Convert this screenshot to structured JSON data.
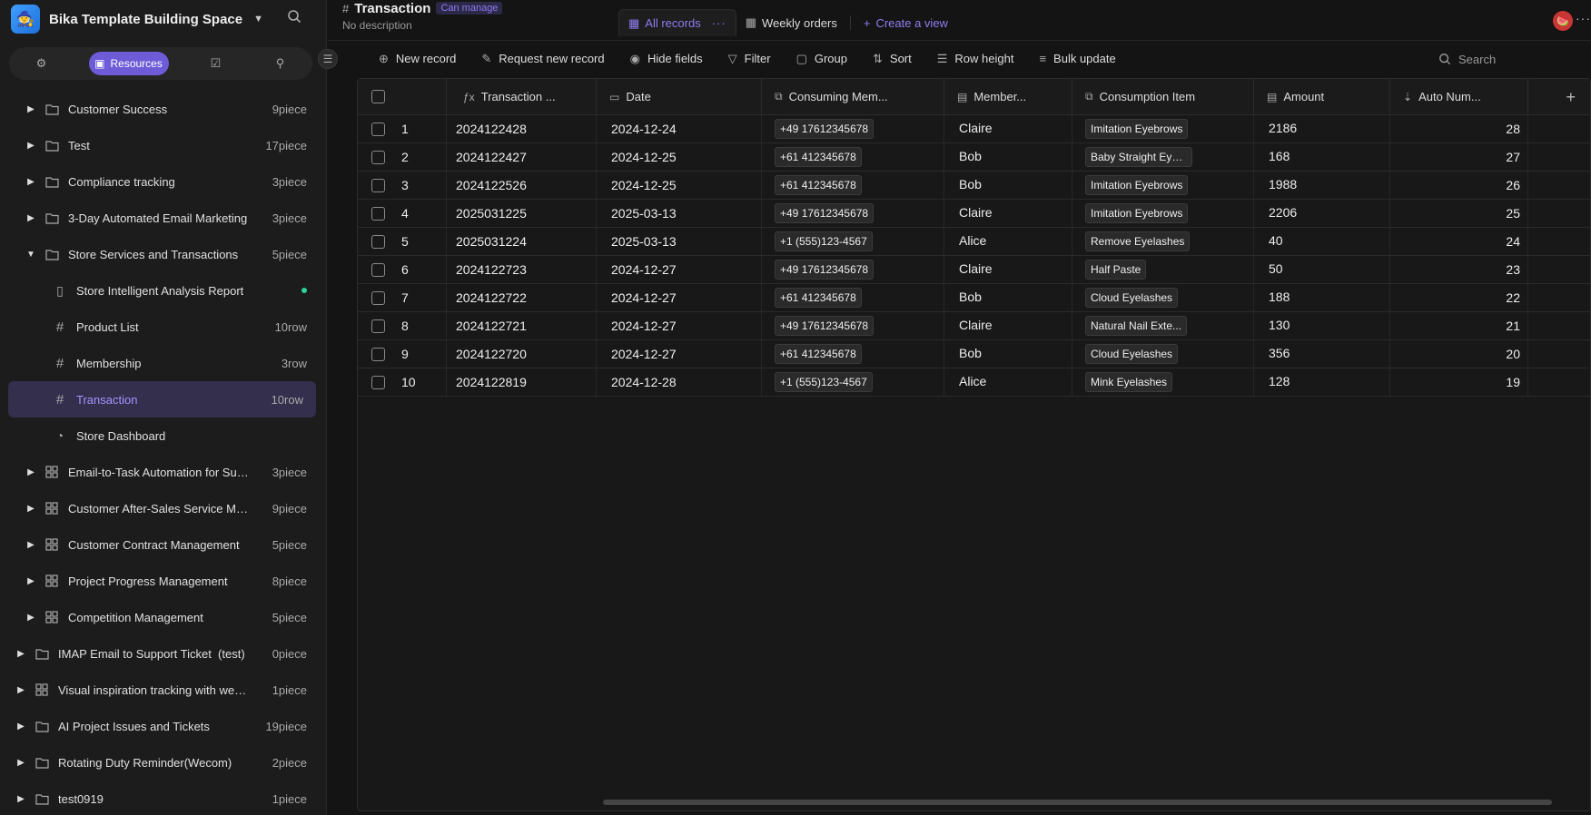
{
  "space": {
    "name": "Bika Template Building Space"
  },
  "sidebar_tabs": {
    "resources": "Resources"
  },
  "tree": [
    {
      "label": "Customer Success",
      "count": "9piece",
      "type": "folder",
      "level": 1,
      "expand": "collapsed"
    },
    {
      "label": "Test",
      "count": "17piece",
      "type": "folder",
      "level": 1,
      "expand": "collapsed"
    },
    {
      "label": "Compliance tracking",
      "count": "3piece",
      "type": "folder",
      "level": 1,
      "expand": "collapsed"
    },
    {
      "label": "3-Day Automated Email Marketing",
      "count": "3piece",
      "type": "folder",
      "level": 1,
      "expand": "collapsed"
    },
    {
      "label": "Store Services and Transactions",
      "count": "5piece",
      "type": "folder",
      "level": 1,
      "expand": "expanded"
    },
    {
      "label": "Store Intelligent Analysis Report",
      "count": "",
      "type": "report",
      "level": 2,
      "dot": true
    },
    {
      "label": "Product List",
      "count": "10row",
      "type": "table",
      "level": 2
    },
    {
      "label": "Membership",
      "count": "3row",
      "type": "table",
      "level": 2
    },
    {
      "label": "Transaction",
      "count": "10row",
      "type": "table",
      "level": 2,
      "active": true
    },
    {
      "label": "Store Dashboard",
      "count": "",
      "type": "dashboard",
      "level": 2
    },
    {
      "label": "Email-to-Task Automation for Sup...",
      "count": "3piece",
      "type": "grid",
      "level": 1,
      "expand": "collapsed"
    },
    {
      "label": "Customer After-Sales Service Ma...",
      "count": "9piece",
      "type": "grid",
      "level": 1,
      "expand": "collapsed"
    },
    {
      "label": "Customer Contract Management",
      "count": "5piece",
      "type": "grid",
      "level": 1,
      "expand": "collapsed"
    },
    {
      "label": "Project Progress Management",
      "count": "8piece",
      "type": "grid",
      "level": 1,
      "expand": "collapsed"
    },
    {
      "label": "Competition Management",
      "count": "5piece",
      "type": "grid",
      "level": 1,
      "expand": "collapsed"
    },
    {
      "label": "IMAP Email to Support Ticket  (test)",
      "count": "0piece",
      "type": "folder",
      "level": 0,
      "expand": "collapsed"
    },
    {
      "label": "Visual inspiration tracking with web ...",
      "count": "1piece",
      "type": "grid",
      "level": 0,
      "expand": "collapsed"
    },
    {
      "label": "AI Project Issues and Tickets",
      "count": "19piece",
      "type": "folder",
      "level": 0,
      "expand": "collapsed"
    },
    {
      "label": "Rotating Duty Reminder(Wecom)",
      "count": "2piece",
      "type": "folder",
      "level": 0,
      "expand": "collapsed"
    },
    {
      "label": "test0919",
      "count": "1piece",
      "type": "folder",
      "level": 0,
      "expand": "collapsed"
    }
  ],
  "header": {
    "title": "Transaction",
    "permission": "Can manage",
    "description": "No description"
  },
  "views": {
    "all": "All records",
    "weekly": "Weekly orders",
    "create": "Create a view"
  },
  "toolbar": {
    "new_record": "New record",
    "request": "Request new record",
    "hide": "Hide fields",
    "filter": "Filter",
    "group": "Group",
    "sort": "Sort",
    "row_height": "Row height",
    "bulk": "Bulk update",
    "search_placeholder": "Search"
  },
  "columns": [
    "Transaction ...",
    "Date",
    "Consuming Mem...",
    "Member...",
    "Consumption Item",
    "Amount",
    "Auto Num..."
  ],
  "records": [
    {
      "n": "1",
      "id": "2024122428",
      "date": "2024-12-24",
      "phone": "+49 17612345678",
      "member": "Claire",
      "item": "Imitation Eyebrows",
      "amount": "2186",
      "auto": "28"
    },
    {
      "n": "2",
      "id": "2024122427",
      "date": "2024-12-25",
      "phone": "+61 412345678",
      "member": "Bob",
      "item": "Baby Straight Eye...",
      "amount": "168",
      "auto": "27"
    },
    {
      "n": "3",
      "id": "2024122526",
      "date": "2024-12-25",
      "phone": "+61 412345678",
      "member": "Bob",
      "item": "Imitation Eyebrows",
      "amount": "1988",
      "auto": "26"
    },
    {
      "n": "4",
      "id": "2025031225",
      "date": "2025-03-13",
      "phone": "+49 17612345678",
      "member": "Claire",
      "item": "Imitation Eyebrows",
      "amount": "2206",
      "auto": "25"
    },
    {
      "n": "5",
      "id": "2025031224",
      "date": "2025-03-13",
      "phone": "+1 (555)123-4567",
      "member": "Alice",
      "item": "Remove Eyelashes",
      "amount": "40",
      "auto": "24"
    },
    {
      "n": "6",
      "id": "2024122723",
      "date": "2024-12-27",
      "phone": "+49 17612345678",
      "member": "Claire",
      "item": "Half Paste",
      "amount": "50",
      "auto": "23"
    },
    {
      "n": "7",
      "id": "2024122722",
      "date": "2024-12-27",
      "phone": "+61 412345678",
      "member": "Bob",
      "item": "Cloud Eyelashes",
      "amount": "188",
      "auto": "22"
    },
    {
      "n": "8",
      "id": "2024122721",
      "date": "2024-12-27",
      "phone": "+49 17612345678",
      "member": "Claire",
      "item": "Natural Nail Exte...",
      "amount": "130",
      "auto": "21"
    },
    {
      "n": "9",
      "id": "2024122720",
      "date": "2024-12-27",
      "phone": "+61 412345678",
      "member": "Bob",
      "item": "Cloud Eyelashes",
      "amount": "356",
      "auto": "20"
    },
    {
      "n": "10",
      "id": "2024122819",
      "date": "2024-12-28",
      "phone": "+1 (555)123-4567",
      "member": "Alice",
      "item": "Mink Eyelashes",
      "amount": "128",
      "auto": "19"
    }
  ],
  "colors": {
    "accent": "#8f7cf0",
    "active_bg": "#332f4d",
    "dot": "#2bd39a"
  }
}
